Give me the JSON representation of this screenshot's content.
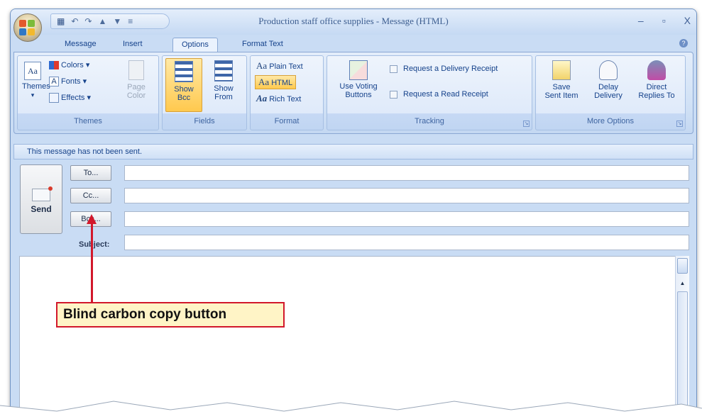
{
  "window": {
    "title": "Production staff office supplies - Message (HTML)",
    "controls": [
      "–",
      "▫",
      "X"
    ]
  },
  "tabs": [
    {
      "label": "Message",
      "active": false
    },
    {
      "label": "Insert",
      "active": false
    },
    {
      "label": "Options",
      "active": true
    },
    {
      "label": "Format Text",
      "active": false
    }
  ],
  "ribbon": {
    "themes": {
      "label": "Themes",
      "themes_button": "Themes",
      "colors": "Colors",
      "fonts": "Fonts",
      "effects": "Effects",
      "page_color": "Page Color"
    },
    "fields": {
      "label": "Fields",
      "show_bcc": "Show Bcc",
      "show_from": "Show From"
    },
    "format": {
      "label": "Format",
      "plain_text": "Plain Text",
      "html": "HTML",
      "rich_text": "Rich Text"
    },
    "tracking": {
      "label": "Tracking",
      "voting": "Use Voting Buttons",
      "delivery_receipt": "Request a Delivery Receipt",
      "read_receipt": "Request a Read Receipt"
    },
    "more_options": {
      "label": "More Options",
      "save_sent": "Save Sent Item",
      "delay": "Delay Delivery",
      "direct_replies": "Direct Replies To"
    }
  },
  "infobar": "This message has not been sent.",
  "header": {
    "send": "Send",
    "to": "To...",
    "cc": "Cc...",
    "bcc": "Bcc...",
    "subject": "Subject:"
  },
  "callout": "Blind carbon copy button",
  "colors": {
    "accent": "#d2182b",
    "callout_bg": "#fff4c6",
    "ribbon": "#dfeafa"
  }
}
